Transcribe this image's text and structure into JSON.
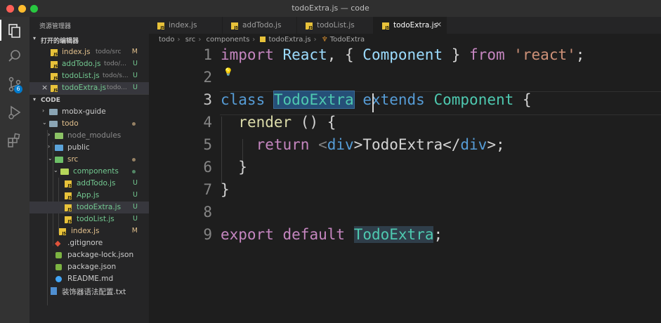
{
  "window": {
    "title": "todoExtra.js — code"
  },
  "activity_bar": {
    "scm_badge": "6"
  },
  "sidebar": {
    "title": "资源管理器",
    "open_editors": {
      "heading": "打开的编辑器",
      "items": [
        {
          "name": "index.js",
          "desc": "todo/src",
          "status": "M"
        },
        {
          "name": "addTodo.js",
          "desc": "todo/...",
          "status": "U"
        },
        {
          "name": "todoList.js",
          "desc": "todo/s...",
          "status": "U"
        },
        {
          "name": "todoExtra.js",
          "desc": "todo...",
          "status": "U"
        }
      ]
    },
    "workspace": {
      "heading": "CODE",
      "items": [
        {
          "name": "mobx-guide"
        },
        {
          "name": "todo"
        },
        {
          "name": "node_modules"
        },
        {
          "name": "public"
        },
        {
          "name": "src"
        },
        {
          "name": "components"
        },
        {
          "name": "addTodo.js",
          "status": "U"
        },
        {
          "name": "App.js",
          "status": "U"
        },
        {
          "name": "todoExtra.js",
          "status": "U"
        },
        {
          "name": "todoList.js",
          "status": "U"
        },
        {
          "name": "index.js",
          "status": "M"
        },
        {
          "name": ".gitignore"
        },
        {
          "name": "package-lock.json"
        },
        {
          "name": "package.json"
        },
        {
          "name": "README.md"
        },
        {
          "name": "装饰器语法配置.txt"
        }
      ]
    }
  },
  "tabs": [
    {
      "label": "index.js"
    },
    {
      "label": "addTodo.js"
    },
    {
      "label": "todoList.js"
    },
    {
      "label": "todoExtra.js"
    }
  ],
  "breadcrumb": [
    "todo",
    "src",
    "components",
    "todoExtra.js",
    "TodoExtra"
  ],
  "editor": {
    "line_numbers": [
      "1",
      "2",
      "3",
      "4",
      "5",
      "6",
      "7",
      "8",
      "9"
    ],
    "l1": {
      "a": "import",
      "b": " React",
      "c": ", { ",
      "d": "Component",
      "e": " } ",
      "f": "from",
      "g": " 'react'",
      "h": ";"
    },
    "l3": {
      "a": "class",
      "b": " ",
      "c": "TodoExtra",
      "d": " extends",
      "e": " ",
      "f": "Component",
      "g": " {"
    },
    "l4": {
      "a": "  ",
      "b": "render",
      "c": " () {"
    },
    "l5": {
      "a": "    ",
      "b": "return",
      "c": " <",
      "d": "div",
      "e": ">TodoExtra</",
      "f": "div",
      "g": ">;"
    },
    "l6": {
      "a": "  }"
    },
    "l7": {
      "a": "}"
    },
    "l9": {
      "a": "export",
      "b": " ",
      "c": "default",
      "d": " ",
      "e": "TodoExtra",
      "f": ";"
    }
  },
  "colors": {
    "modified": "#e2c08d",
    "untracked": "#73c991",
    "accent": "#007acc"
  }
}
